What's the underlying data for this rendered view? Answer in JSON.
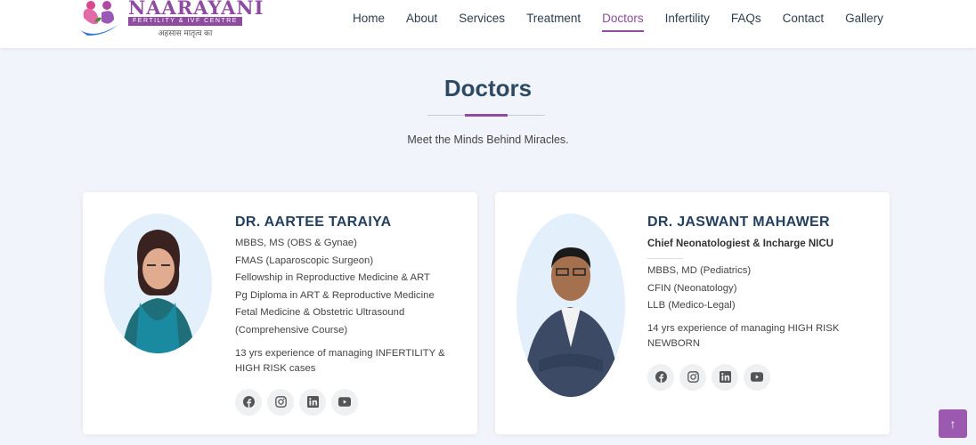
{
  "logo": {
    "name": "NAARAYANI",
    "subtitle": "FERTILITY & IVF CENTRE",
    "tagline": "अहसास मातृत्व का"
  },
  "nav": {
    "items": [
      "Home",
      "About",
      "Services",
      "Treatment",
      "Doctors",
      "Infertility",
      "FAQs",
      "Contact",
      "Gallery"
    ],
    "active": "Doctors"
  },
  "page": {
    "title": "Doctors",
    "subtitle": "Meet the Minds Behind Miracles."
  },
  "doctors": [
    {
      "name": "DR. AARTEE TARAIYA",
      "qualifications": [
        "MBBS, MS (OBS & Gynae)",
        "FMAS (Laparoscopic Surgeon)",
        "Fellowship in Reproductive Medicine & ART",
        "Pg Diploma in ART & Reproductive Medicine",
        "Fetal Medicine & Obstetric Ultrasound",
        "(Comprehensive Course)"
      ],
      "experience": "13 yrs experience of managing INFERTILITY & HIGH RISK cases"
    },
    {
      "name": "DR. JASWANT MAHAWER",
      "role": "Chief Neonatologiest & Incharge NICU",
      "qualifications": [
        "MBBS, MD (Pediatrics)",
        "CFIN (Neonatology)",
        "LLB (Medico-Legal)"
      ],
      "experience": "14 yrs experience of managing HIGH RISK NEWBORN"
    }
  ],
  "social_icons": [
    "facebook-icon",
    "instagram-icon",
    "linkedin-icon",
    "youtube-icon"
  ],
  "colors": {
    "accent": "#8e4ba0",
    "heading": "#24405e"
  }
}
